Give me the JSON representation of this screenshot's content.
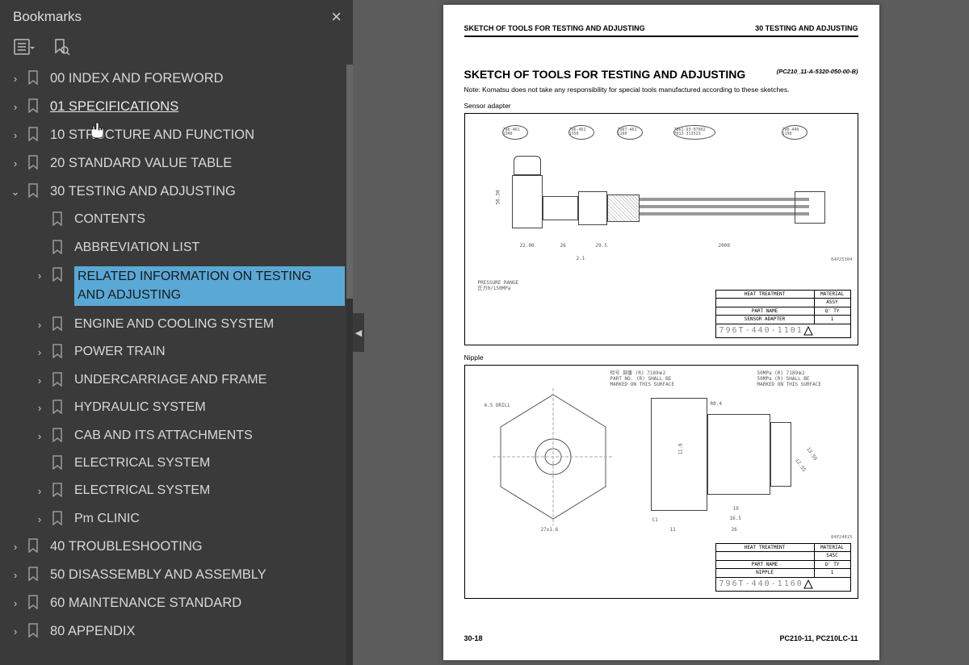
{
  "sidebar": {
    "title": "Bookmarks",
    "items": [
      {
        "label": "00 INDEX AND FOREWORD",
        "level": 0,
        "chev": "right"
      },
      {
        "label": "01 SPECIFICATIONS",
        "level": 0,
        "chev": "right",
        "hover": true
      },
      {
        "label": "10 STRUCTURE AND FUNCTION",
        "level": 0,
        "chev": "right"
      },
      {
        "label": "20 STANDARD VALUE TABLE",
        "level": 0,
        "chev": "right"
      },
      {
        "label": "30 TESTING AND ADJUSTING",
        "level": 0,
        "chev": "down"
      },
      {
        "label": "CONTENTS",
        "level": 1,
        "chev": ""
      },
      {
        "label": "ABBREVIATION LIST",
        "level": 1,
        "chev": ""
      },
      {
        "label": "RELATED INFORMATION ON TESTING AND ADJUSTING",
        "level": 1,
        "chev": "right",
        "selected": true
      },
      {
        "label": "ENGINE AND COOLING SYSTEM",
        "level": 1,
        "chev": "right"
      },
      {
        "label": "POWER TRAIN",
        "level": 1,
        "chev": "right"
      },
      {
        "label": "UNDERCARRIAGE AND FRAME",
        "level": 1,
        "chev": "right"
      },
      {
        "label": "HYDRAULIC SYSTEM",
        "level": 1,
        "chev": "right"
      },
      {
        "label": "CAB AND ITS ATTACHMENTS",
        "level": 1,
        "chev": "right"
      },
      {
        "label": "ELECTRICAL SYSTEM",
        "level": 1,
        "chev": ""
      },
      {
        "label": "ELECTRICAL SYSTEM",
        "level": 1,
        "chev": "right"
      },
      {
        "label": "Pm CLINIC",
        "level": 1,
        "chev": "right"
      },
      {
        "label": "40 TROUBLESHOOTING",
        "level": 0,
        "chev": "right"
      },
      {
        "label": "50 DISASSEMBLY AND ASSEMBLY",
        "level": 0,
        "chev": "right"
      },
      {
        "label": "60 MAINTENANCE STANDARD",
        "level": 0,
        "chev": "right"
      },
      {
        "label": "80 APPENDIX",
        "level": 0,
        "chev": "right"
      }
    ]
  },
  "page": {
    "header_left": "SKETCH OF TOOLS FOR TESTING AND ADJUSTING",
    "header_right": "30 TESTING AND ADJUSTING",
    "title": "SKETCH OF TOOLS FOR TESTING AND ADJUSTING",
    "code": "(PC210_11-A-5320-050-00-B)",
    "note": "Note: Komatsu does not take any responsibility for special tools manufactured according to these sketches.",
    "fig1_label": "Sensor adapter",
    "fig2_label": "Nipple",
    "dnum1": "84P25304",
    "dnum2": "84P24815",
    "box_hdr_left": "HEAT TREATMENT",
    "box_hdr_right": "MATERIAL",
    "box_part_label": "PART NAME",
    "box_qty": "Q' TY",
    "fig1_material": "ASSY",
    "fig1_partname": "SENSOR ADAPTER",
    "fig1_qty": "1",
    "fig1_partnum": "796T-440-1101",
    "fig2_material": "S45C",
    "fig2_partname": "NIPPLE",
    "fig2_qty": "1",
    "fig2_partnum": "796T-440-1160",
    "press_range_a": "PRESSURE RANGE",
    "press_range_b": "圧力0/150MPa",
    "call1": "796-461\n1340",
    "call2": "796-461\n1350",
    "call3": "796T-461\n1160",
    "call4": "7861-93-07002\n7013  313523",
    "call5": "796-446\n1190",
    "dim_a": "56.30",
    "dim_b": "22.00",
    "dim_c": "26",
    "dim_d": "29.5",
    "dim_e": "2.1",
    "dim_f": "2000",
    "n_lbl1": "4.5 DRILL",
    "n_lbl2": "27±1.6",
    "n_lbl3": "11",
    "n_lbl4": "26",
    "n_lbl5": "16.5",
    "n_lbl6": "19",
    "n_lbl7": "C1",
    "n_lbl8": "12.55",
    "n_lbl9": "13.59",
    "n_lbl10": "11.6",
    "n_lbl11": "R0.4",
    "n_note1a": "检号 部番 (R) 7189※2",
    "n_note1b": "PART NO. (R) SHALL BE",
    "n_note1c": "MARKED ON THIS SURFACE",
    "n_note2a": "50MPa (R) 7189※2",
    "n_note2b": "50MPa (R) SHALL BE",
    "n_note2c": "MARKED ON THIS SURFACE",
    "footer_left": "30-18",
    "footer_right": "PC210-11, PC210LC-11"
  }
}
